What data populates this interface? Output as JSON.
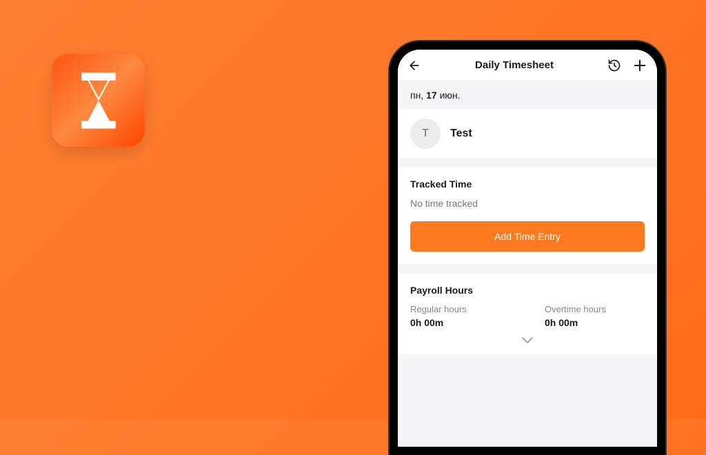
{
  "header": {
    "title": "Daily Timesheet"
  },
  "date": {
    "weekday": "пн,",
    "day": "17",
    "month": "июн."
  },
  "profile": {
    "initial": "T",
    "name": "Test"
  },
  "tracked": {
    "title": "Tracked Time",
    "empty_message": "No time tracked",
    "add_button": "Add Time Entry"
  },
  "payroll": {
    "title": "Payroll Hours",
    "regular_label": "Regular hours",
    "regular_value": "0h 00m",
    "overtime_label": "Overtime hours",
    "overtime_value": "0h 00m"
  },
  "colors": {
    "accent": "#ff7a1f"
  }
}
